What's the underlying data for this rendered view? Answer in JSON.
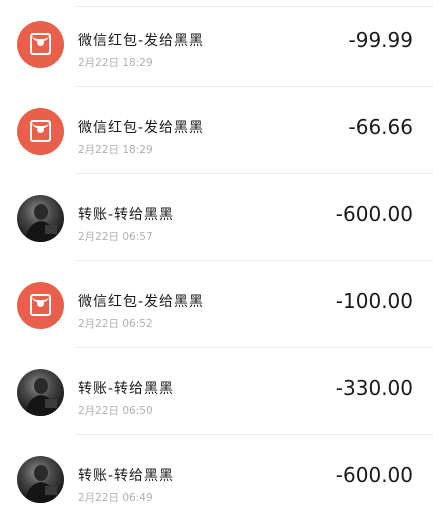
{
  "transactions": [
    {
      "title": "微信红包-发给黑黑",
      "time": "2月22日 18:29",
      "amount": "-99.99",
      "icon": "red-packet-icon"
    },
    {
      "title": "微信红包-发给黑黑",
      "time": "2月22日 18:29",
      "amount": "-66.66",
      "icon": "red-packet-icon"
    },
    {
      "title": "转账-转给黑黑",
      "time": "2月22日 06:57",
      "amount": "-600.00",
      "icon": "avatar"
    },
    {
      "title": "微信红包-发给黑黑",
      "time": "2月22日 06:52",
      "amount": "-100.00",
      "icon": "red-packet-icon"
    },
    {
      "title": "转账-转给黑黑",
      "time": "2月22日 06:50",
      "amount": "-330.00",
      "icon": "avatar"
    },
    {
      "title": "转账-转给黑黑",
      "time": "2月22日 06:49",
      "amount": "-600.00",
      "icon": "avatar"
    }
  ],
  "colors": {
    "red_packet": "#e8604c",
    "divider": "#ececec",
    "time_text": "#b0b0b0",
    "amount_text": "#1a1a1a"
  }
}
